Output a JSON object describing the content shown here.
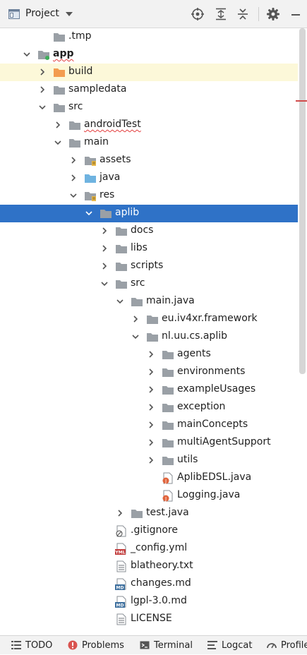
{
  "header": {
    "title": "Project",
    "icons": [
      "project-view-icon",
      "dropdown-caret-icon",
      "locate-icon",
      "expand-all-icon",
      "collapse-all-icon",
      "gear-icon",
      "minimize-icon"
    ]
  },
  "colors": {
    "folder": "#9aa0a6",
    "excluded_folder": "#f39c4f",
    "source_folder": "#6fb3e0",
    "selection": "#2f72c7",
    "highlight_row": "#fcf8d9"
  },
  "tree": [
    {
      "label": ".tmp",
      "depth": 2,
      "icon": "folder",
      "chevron": "none"
    },
    {
      "label": "app",
      "depth": 1,
      "icon": "module-folder",
      "chevron": "open",
      "bold": true,
      "squiggle": true
    },
    {
      "label": "build",
      "depth": 2,
      "icon": "excluded-folder",
      "chevron": "closed",
      "highlight": true
    },
    {
      "label": "sampledata",
      "depth": 2,
      "icon": "folder",
      "chevron": "closed"
    },
    {
      "label": "src",
      "depth": 2,
      "icon": "folder",
      "chevron": "open"
    },
    {
      "label": "androidTest",
      "depth": 3,
      "icon": "folder",
      "chevron": "closed",
      "squiggle": true
    },
    {
      "label": "main",
      "depth": 3,
      "icon": "folder",
      "chevron": "open"
    },
    {
      "label": "assets",
      "depth": 4,
      "icon": "resource-folder",
      "chevron": "closed"
    },
    {
      "label": "java",
      "depth": 4,
      "icon": "source-folder",
      "chevron": "closed"
    },
    {
      "label": "res",
      "depth": 4,
      "icon": "resource-folder",
      "chevron": "open"
    },
    {
      "label": "aplib",
      "depth": 5,
      "icon": "folder",
      "chevron": "open",
      "selected": true
    },
    {
      "label": "docs",
      "depth": 6,
      "icon": "folder",
      "chevron": "closed"
    },
    {
      "label": "libs",
      "depth": 6,
      "icon": "folder",
      "chevron": "closed"
    },
    {
      "label": "scripts",
      "depth": 6,
      "icon": "folder",
      "chevron": "closed"
    },
    {
      "label": "src",
      "depth": 6,
      "icon": "folder",
      "chevron": "open"
    },
    {
      "label": "main.java",
      "depth": 7,
      "icon": "folder",
      "chevron": "open"
    },
    {
      "label": "eu.iv4xr.framework",
      "depth": 8,
      "icon": "folder",
      "chevron": "closed"
    },
    {
      "label": "nl.uu.cs.aplib",
      "depth": 8,
      "icon": "folder",
      "chevron": "open"
    },
    {
      "label": "agents",
      "depth": 9,
      "icon": "folder",
      "chevron": "closed"
    },
    {
      "label": "environments",
      "depth": 9,
      "icon": "folder",
      "chevron": "closed"
    },
    {
      "label": "exampleUsages",
      "depth": 9,
      "icon": "folder",
      "chevron": "closed"
    },
    {
      "label": "exception",
      "depth": 9,
      "icon": "folder",
      "chevron": "closed"
    },
    {
      "label": "mainConcepts",
      "depth": 9,
      "icon": "folder",
      "chevron": "closed"
    },
    {
      "label": "multiAgentSupport",
      "depth": 9,
      "icon": "folder",
      "chevron": "closed"
    },
    {
      "label": "utils",
      "depth": 9,
      "icon": "folder",
      "chevron": "closed"
    },
    {
      "label": "AplibEDSL.java",
      "depth": 9,
      "icon": "java-file",
      "chevron": "none"
    },
    {
      "label": "Logging.java",
      "depth": 9,
      "icon": "java-file",
      "chevron": "none"
    },
    {
      "label": "test.java",
      "depth": 7,
      "icon": "folder",
      "chevron": "closed"
    },
    {
      "label": ".gitignore",
      "depth": 6,
      "icon": "ignore-file",
      "chevron": "none"
    },
    {
      "label": "_config.yml",
      "depth": 6,
      "icon": "yml-file",
      "chevron": "none"
    },
    {
      "label": "blatheory.txt",
      "depth": 6,
      "icon": "text-file",
      "chevron": "none"
    },
    {
      "label": "changes.md",
      "depth": 6,
      "icon": "md-file",
      "chevron": "none"
    },
    {
      "label": "lgpl-3.0.md",
      "depth": 6,
      "icon": "md-file",
      "chevron": "none"
    },
    {
      "label": "LICENSE",
      "depth": 6,
      "icon": "text-file",
      "chevron": "none"
    }
  ],
  "bottom_tabs": [
    {
      "label": "TODO",
      "icon": "todo-list-icon"
    },
    {
      "label": "Problems",
      "icon": "problems-icon"
    },
    {
      "label": "Terminal",
      "icon": "terminal-icon"
    },
    {
      "label": "Logcat",
      "icon": "logcat-icon"
    },
    {
      "label": "Profile",
      "icon": "profiler-icon"
    }
  ]
}
